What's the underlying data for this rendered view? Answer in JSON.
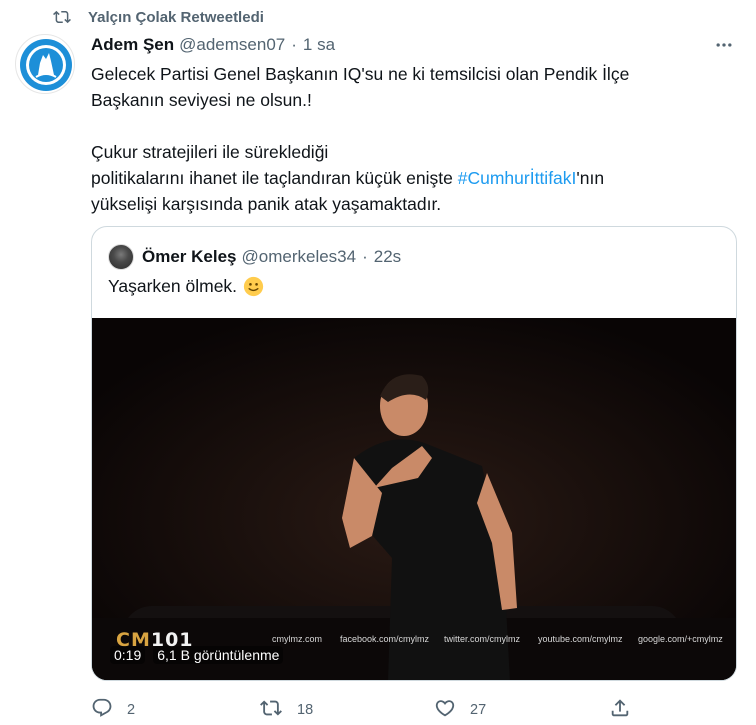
{
  "retweet_banner": {
    "text": "Yalçın Çolak Retweetledi",
    "icon": "retweet-icon"
  },
  "tweet": {
    "author_name": "Adem Şen",
    "author_handle": "@ademsen07",
    "separator": "·",
    "time": "1 sa",
    "text_lines": [
      "Gelecek Partisi Genel Başkanın IQ'su ne ki temsilcisi olan Pendik İlçe",
      "Başkanın seviyesi ne olsun.!",
      "Çukur stratejileri ile süreklediği",
      "politikalarını ihanet ile taçlandıran küçük enişte ",
      "#CumhurİttifakI",
      "'nın",
      "yükselişi karşısında panik atak yaşamaktadır."
    ]
  },
  "quote": {
    "author_name": "Ömer Keleş",
    "author_handle": "@omerkeles34",
    "separator": "·",
    "time": "22s",
    "text": "Yaşarken ölmek.",
    "emoji": "slightly-smiling-face-icon",
    "video": {
      "logo_cm": "CM",
      "logo_num": "101",
      "watermarks": [
        "cmylmz.com",
        "facebook.com/cmylmz",
        "twitter.com/cmylmz",
        "youtube.com/cmylmz",
        "google.com/+cmylmz"
      ],
      "time": "0:19",
      "views": "6,1 B görüntülenme"
    }
  },
  "actions": {
    "reply_count": "2",
    "retweet_count": "18",
    "like_count": "27"
  },
  "colors": {
    "accent": "#1d9bf0",
    "muted": "#536471",
    "text": "#0f1419",
    "border": "#cfd9de"
  }
}
